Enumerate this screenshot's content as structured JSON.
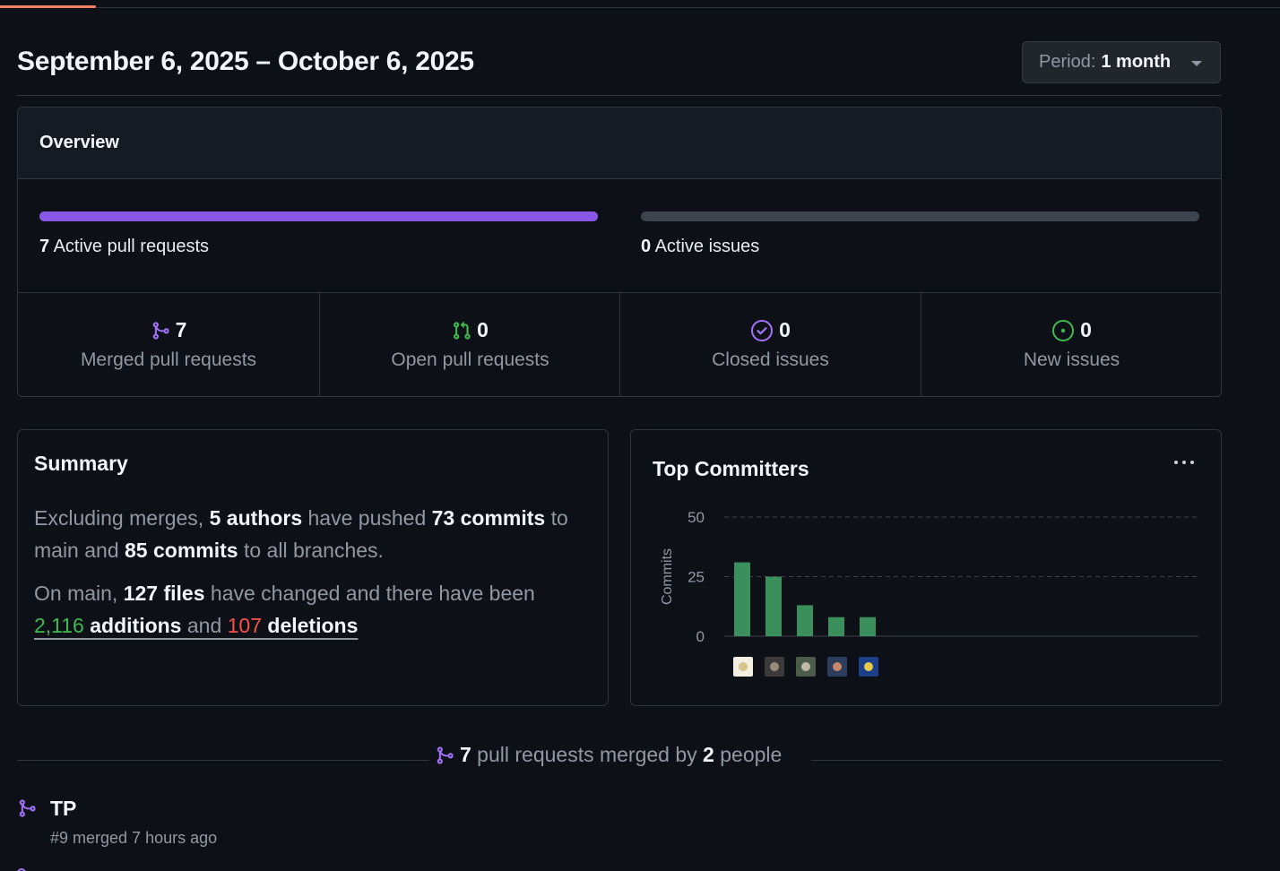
{
  "header": {
    "date_range": "September 6, 2025 – October 6, 2025",
    "period_label": "Period:",
    "period_value": "1 month"
  },
  "overview": {
    "title": "Overview",
    "active_prs": {
      "count": "7",
      "label": "Active pull requests",
      "fill_fraction": 1.0,
      "color": "#8957e5"
    },
    "active_issues": {
      "count": "0",
      "label": "Active issues",
      "fill_fraction": 0.0
    },
    "stats": [
      {
        "icon": "git-merge-icon",
        "value": "7",
        "label": "Merged pull requests",
        "color": "#a371f7"
      },
      {
        "icon": "git-pull-request-icon",
        "value": "0",
        "label": "Open pull requests",
        "color": "#3fb950"
      },
      {
        "icon": "issue-closed-icon",
        "value": "0",
        "label": "Closed issues",
        "color": "#a371f7"
      },
      {
        "icon": "issue-opened-icon",
        "value": "0",
        "label": "New issues",
        "color": "#3fb950"
      }
    ]
  },
  "summary": {
    "title": "Summary",
    "p1": {
      "t1": "Excluding merges, ",
      "authors": "5 authors",
      "t2": " have pushed ",
      "main_commits": "73 commits",
      "t3": " to main and ",
      "all_commits": "85 commits",
      "t4": " to all branches."
    },
    "p2": {
      "t1": "On main, ",
      "files": "127 files",
      "t2": " have changed and there have been ",
      "additions_num": "2,116",
      "additions_word": " additions",
      "t3": " and ",
      "deletions_num": "107",
      "deletions_word": " deletions"
    }
  },
  "top_committers": {
    "title": "Top Committers",
    "more_icon": "kebab-horizontal-icon"
  },
  "chart_data": {
    "type": "bar",
    "ylabel": "Commits",
    "ylim": [
      0,
      50
    ],
    "yticks": [
      "0",
      "25",
      "50"
    ],
    "values": [
      31,
      25,
      13,
      8,
      8
    ],
    "bar_color": "#3a8f5c",
    "grid": true
  },
  "merged_summary": {
    "count": "7",
    "t1": " pull requests merged by ",
    "people": "2",
    "t2": " people"
  },
  "pull_requests": [
    {
      "title": "TP",
      "meta": "#9 merged 7 hours ago"
    }
  ]
}
